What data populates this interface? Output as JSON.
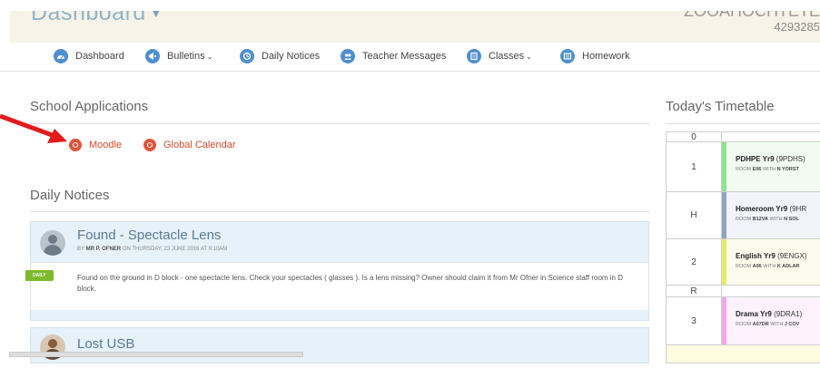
{
  "header": {
    "title": "Dashboard",
    "user_name": "ZOOAHOCHTETE",
    "user_id": "4293285"
  },
  "nav": [
    {
      "label": "Dashboard",
      "icon": "dashboard-icon",
      "dropdown": false
    },
    {
      "label": "Bulletins",
      "icon": "bulletins-icon",
      "dropdown": true
    },
    {
      "label": "Daily Notices",
      "icon": "notices-icon",
      "dropdown": false
    },
    {
      "label": "Teacher Messages",
      "icon": "messages-icon",
      "dropdown": false
    },
    {
      "label": "Classes",
      "icon": "classes-icon",
      "dropdown": true
    },
    {
      "label": "Homework",
      "icon": "homework-icon",
      "dropdown": false
    }
  ],
  "applications": {
    "heading": "School Applications",
    "links": [
      {
        "label": "Moodle",
        "icon": "moodle-icon"
      },
      {
        "label": "Global Calendar",
        "icon": "calendar-icon"
      }
    ]
  },
  "daily_notices": {
    "heading": "Daily Notices",
    "items": [
      {
        "title": "Found - Spectacle Lens",
        "by_prefix": "BY",
        "author": "MR P. OFNER",
        "date": "ON THURSDAY, 23 JUNE 2016 AT 9:10AM",
        "tag": "DAILY",
        "body": "Found on the ground in D block - one spectacle lens. Check your spectacles ( glasses ). Is a lens missing? Owner should claim it from Mr Ofner in Science staff room in D block."
      },
      {
        "title": "Lost USB"
      }
    ]
  },
  "timetable": {
    "heading": "Today's Timetable",
    "rows": [
      {
        "period": "0"
      },
      {
        "period": "1",
        "class": "PDHPE Yr9",
        "code": "(9PDHS)",
        "room_prefix": "ROOM",
        "room": "E06",
        "with": "WITH",
        "teacher": "N YORST",
        "color": "#8ee48e"
      },
      {
        "period": "H",
        "class": "Homeroom Yr9",
        "code": "(9HR",
        "room_prefix": "ROOM",
        "room": "B12VA",
        "with": "WITH",
        "teacher": "N SOL",
        "color": "#8fa3c8"
      },
      {
        "period": "2",
        "class": "English Yr9",
        "code": "(9ENGX)",
        "room_prefix": "ROOM",
        "room": "A06",
        "with": "WITH",
        "teacher": "K ADLAR",
        "color": "#e8e86a"
      },
      {
        "period": "R"
      },
      {
        "period": "3",
        "class": "Drama Yr9",
        "code": "(9DRA1)",
        "room_prefix": "ROOM",
        "room": "A07DR",
        "with": "WITH",
        "teacher": "J COV",
        "color": "#f0a6f0"
      }
    ]
  },
  "colors": {
    "accent_blue": "#4e8fd0",
    "app_red": "#e0553a",
    "notice_bg": "#e6f1f9",
    "tag_green": "#7cbb2d",
    "pointer_arrow": "#e31b1b"
  }
}
